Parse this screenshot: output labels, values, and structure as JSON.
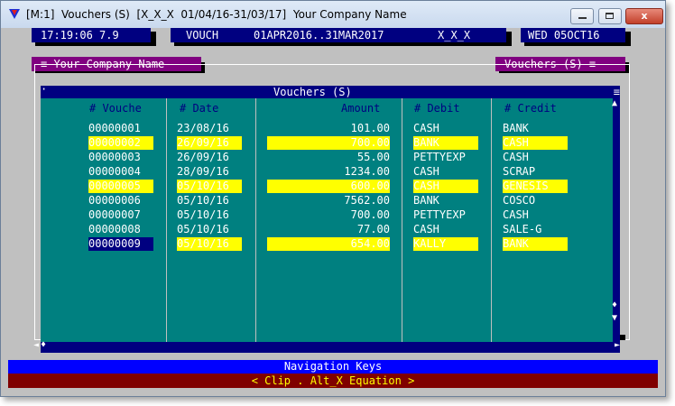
{
  "window": {
    "title": "[M:1]  Vouchers (S)  [X_X_X  01/04/16-31/03/17]  Your Company Name",
    "minimize_glyph": "",
    "close_glyph": "x"
  },
  "statusbar": {
    "time": "17:19:06 7.9",
    "module": "VOUCH",
    "period": "01APR2016..31MAR2017",
    "company_code": "X_X_X",
    "date": "WED 05OCT16"
  },
  "tabs": {
    "left": "≡ Your Company Name",
    "right": "Vouchers (S) ≡"
  },
  "vouchers_window": {
    "title": "Vouchers (S)",
    "menu_glyph": "≡",
    "corner_glyph": "·",
    "scroll_up": "▲",
    "scroll_down": "▼",
    "scroll_thumb": "♦",
    "left_arrow": "◄",
    "right_arrow": "►",
    "left_thumb": "♦",
    "columns": [
      "# Vouche",
      "# Date",
      "Amount",
      "# Debit",
      "# Credit"
    ],
    "rows": [
      {
        "no": "00000001",
        "date": "23/08/16",
        "amount": "101.00",
        "debit": "CASH",
        "credit": "BANK",
        "highlight": false,
        "selected": false
      },
      {
        "no": "00000002",
        "date": "26/09/16",
        "amount": "700.00",
        "debit": "BANK",
        "credit": "CASH",
        "highlight": true,
        "selected": false
      },
      {
        "no": "00000003",
        "date": "26/09/16",
        "amount": "55.00",
        "debit": "PETTYEXP",
        "credit": "CASH",
        "highlight": false,
        "selected": false
      },
      {
        "no": "00000004",
        "date": "28/09/16",
        "amount": "1234.00",
        "debit": "CASH",
        "credit": "SCRAP",
        "highlight": false,
        "selected": false
      },
      {
        "no": "00000005",
        "date": "05/10/16",
        "amount": "600.00",
        "debit": "CASH",
        "credit": "GENESIS",
        "highlight": true,
        "selected": false
      },
      {
        "no": "00000006",
        "date": "05/10/16",
        "amount": "7562.00",
        "debit": "BANK",
        "credit": "COSCO",
        "highlight": false,
        "selected": false
      },
      {
        "no": "00000007",
        "date": "05/10/16",
        "amount": "700.00",
        "debit": "PETTYEXP",
        "credit": "CASH",
        "highlight": false,
        "selected": false
      },
      {
        "no": "00000008",
        "date": "05/10/16",
        "amount": "77.00",
        "debit": "CASH",
        "credit": "SALE-G",
        "highlight": false,
        "selected": false
      },
      {
        "no": "00000009",
        "date": "05/10/16",
        "amount": "654.00",
        "debit": "KALLY",
        "credit": "BANK",
        "highlight": true,
        "selected": true
      }
    ]
  },
  "bottom": {
    "nav_keys": "Navigation Keys",
    "hint": "< Clip . Alt_X Equation >"
  },
  "colors": {
    "teal": "#008080",
    "navy": "#000080",
    "highlight": "#ffff00",
    "purple": "#800080",
    "maroon": "#800000",
    "blue": "#0000ff"
  }
}
